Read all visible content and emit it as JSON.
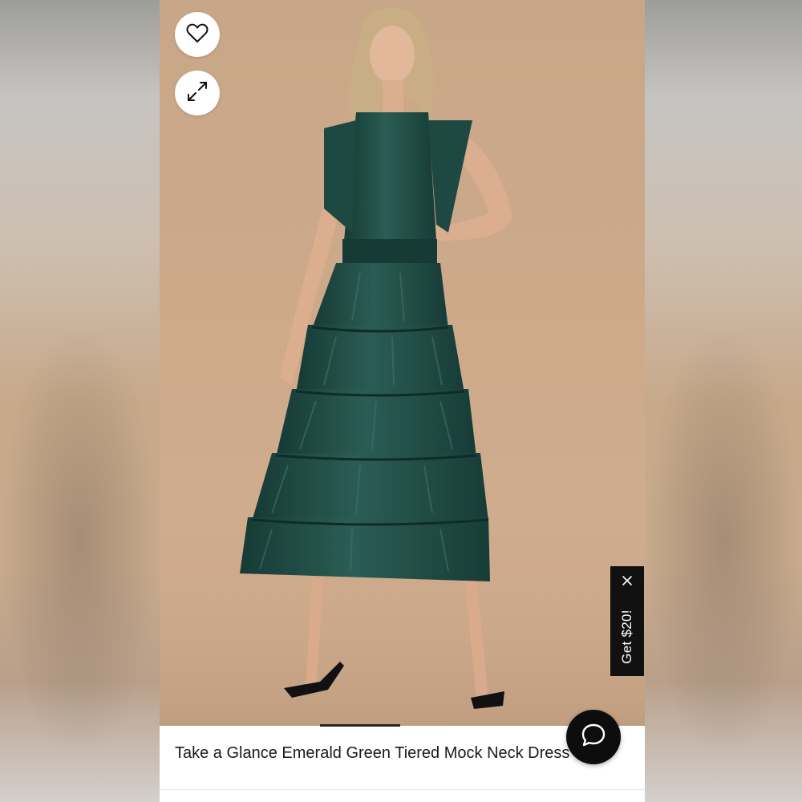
{
  "product": {
    "title": "Take a Glance Emerald Green Tiered Mock Neck Dress",
    "image_alt": "Model wearing emerald green tiered mock neck midi dress"
  },
  "actions": {
    "favorite_icon": "heart-icon",
    "expand_icon": "expand-icon",
    "chat_icon": "chat-bubble-icon"
  },
  "promo": {
    "label": "Get $20!",
    "close_icon": "close-icon"
  },
  "gallery": {
    "active_index": 1
  },
  "colors": {
    "dress": "#1f4a44",
    "backdrop": "#cba98a",
    "promo_bg": "#111111",
    "chat_bg": "#0d0d0d"
  }
}
